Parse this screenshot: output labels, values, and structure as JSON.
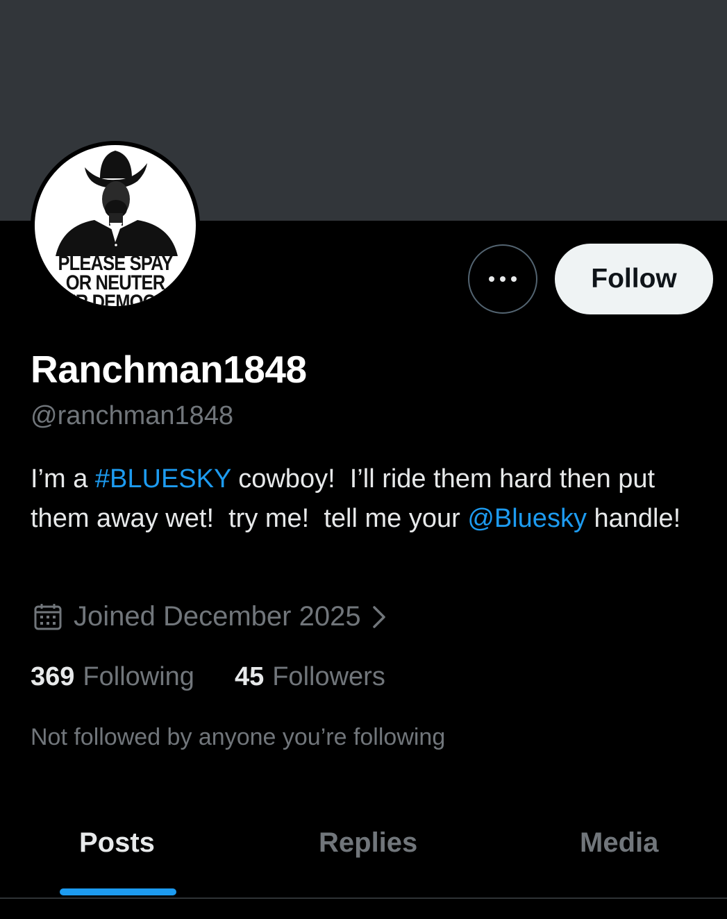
{
  "banner": {
    "color": "#32363a"
  },
  "avatar": {
    "caption_line1": "PLEASE SPAY",
    "caption_line2": "OR NEUTER",
    "caption_line3": "UR DEMOCR"
  },
  "actions": {
    "more_icon": "more-dots-icon",
    "follow_label": "Follow"
  },
  "profile": {
    "display_name": "Ranchman1848",
    "handle": "@ranchman1848",
    "bio": {
      "part1": "I’m a ",
      "hashtag": "#BLUESKY",
      "part2": " cowboy!  I’ll ride them hard then put them away wet!  try me!  tell me your ",
      "mention": "@Bluesky",
      "part3": " handle!"
    },
    "joined": "Joined December 2025",
    "following_count": "369",
    "following_label": "Following",
    "followers_count": "45",
    "followers_label": "Followers",
    "not_followed": "Not followed by anyone you’re following"
  },
  "tabs": [
    {
      "label": "Posts",
      "active": true
    },
    {
      "label": "Replies",
      "active": false
    },
    {
      "label": "Media",
      "active": false
    }
  ],
  "colors": {
    "accent": "#1d9bf0",
    "muted_text": "#71767b",
    "follow_button_bg": "#eff3f4"
  }
}
